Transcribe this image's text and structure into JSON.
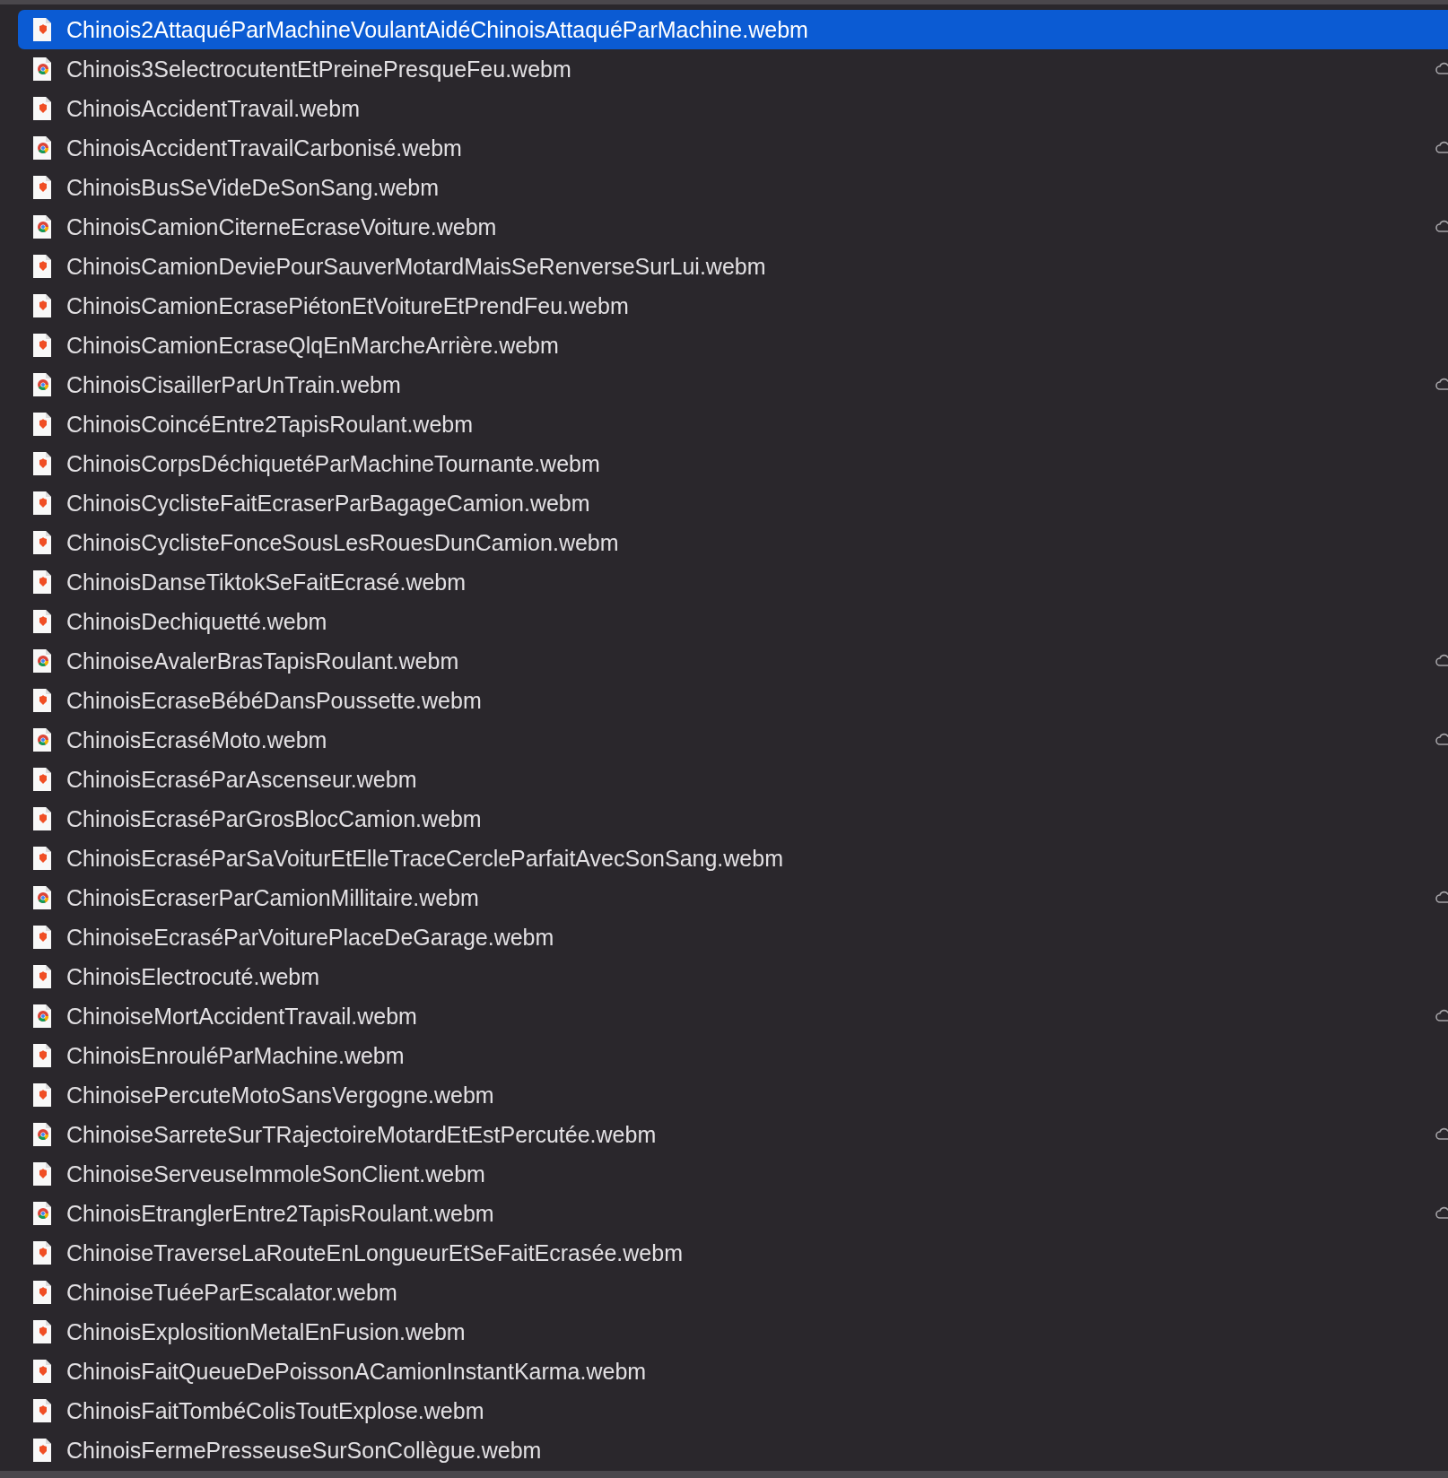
{
  "files": [
    {
      "name": "Chinois2AttaquéParMachineVoulantAidéChinoisAttaquéParMachine.webm",
      "kind": "shield",
      "cloud": false,
      "selected": true
    },
    {
      "name": "Chinois3SelectrocutentEtPreinePresqueFeu.webm",
      "kind": "globe",
      "cloud": true,
      "selected": false
    },
    {
      "name": "ChinoisAccidentTravail.webm",
      "kind": "shield",
      "cloud": false,
      "selected": false
    },
    {
      "name": "ChinoisAccidentTravailCarbonisé.webm",
      "kind": "globe",
      "cloud": true,
      "selected": false
    },
    {
      "name": "ChinoisBusSeVideDeSonSang.webm",
      "kind": "shield",
      "cloud": false,
      "selected": false
    },
    {
      "name": "ChinoisCamionCiterneEcraseVoiture.webm",
      "kind": "globe",
      "cloud": true,
      "selected": false
    },
    {
      "name": "ChinoisCamionDeviePourSauverMotardMaisSeRenverseSurLui.webm",
      "kind": "shield",
      "cloud": false,
      "selected": false
    },
    {
      "name": "ChinoisCamionEcrasePiétonEtVoitureEtPrendFeu.webm",
      "kind": "shield",
      "cloud": false,
      "selected": false
    },
    {
      "name": "ChinoisCamionEcraseQlqEnMarcheArrière.webm",
      "kind": "shield",
      "cloud": false,
      "selected": false
    },
    {
      "name": "ChinoisCisaillerParUnTrain.webm",
      "kind": "globe",
      "cloud": true,
      "selected": false
    },
    {
      "name": "ChinoisCoincéEntre2TapisRoulant.webm",
      "kind": "shield",
      "cloud": false,
      "selected": false
    },
    {
      "name": "ChinoisCorpsDéchiquetéParMachineTournante.webm",
      "kind": "shield",
      "cloud": false,
      "selected": false
    },
    {
      "name": "ChinoisCyclisteFaitEcraserParBagageCamion.webm",
      "kind": "shield",
      "cloud": false,
      "selected": false
    },
    {
      "name": "ChinoisCyclisteFonceSousLesRouesDunCamion.webm",
      "kind": "shield",
      "cloud": false,
      "selected": false
    },
    {
      "name": "ChinoisDanseTiktokSeFaitEcrasé.webm",
      "kind": "shield",
      "cloud": false,
      "selected": false
    },
    {
      "name": "ChinoisDechiquetté.webm",
      "kind": "shield",
      "cloud": false,
      "selected": false
    },
    {
      "name": "ChinoiseAvalerBrasTapisRoulant.webm",
      "kind": "globe",
      "cloud": true,
      "selected": false
    },
    {
      "name": "ChinoisEcraseBébéDansPoussette.webm",
      "kind": "shield",
      "cloud": false,
      "selected": false
    },
    {
      "name": "ChinoisEcraséMoto.webm",
      "kind": "globe",
      "cloud": true,
      "selected": false
    },
    {
      "name": "ChinoisEcraséParAscenseur.webm",
      "kind": "shield",
      "cloud": false,
      "selected": false
    },
    {
      "name": "ChinoisEcraséParGrosBlocCamion.webm",
      "kind": "shield",
      "cloud": false,
      "selected": false
    },
    {
      "name": "ChinoisEcraséParSaVoiturEtElleTraceCercleParfaitAvecSonSang.webm",
      "kind": "shield",
      "cloud": false,
      "selected": false
    },
    {
      "name": "ChinoisEcraserParCamionMillitaire.webm",
      "kind": "globe",
      "cloud": true,
      "selected": false
    },
    {
      "name": "ChinoiseEcraséParVoiturePlaceDeGarage.webm",
      "kind": "shield",
      "cloud": false,
      "selected": false
    },
    {
      "name": "ChinoisElectrocuté.webm",
      "kind": "shield",
      "cloud": false,
      "selected": false
    },
    {
      "name": "ChinoiseMortAccidentTravail.webm",
      "kind": "globe",
      "cloud": true,
      "selected": false
    },
    {
      "name": "ChinoisEnrouléParMachine.webm",
      "kind": "shield",
      "cloud": false,
      "selected": false
    },
    {
      "name": "ChinoisePercuteMotoSansVergogne.webm",
      "kind": "shield",
      "cloud": false,
      "selected": false
    },
    {
      "name": "ChinoiseSarreteSurTRajectoireMotardEtEstPercutée.webm",
      "kind": "globe",
      "cloud": true,
      "selected": false
    },
    {
      "name": "ChinoiseServeuseImmoleSonClient.webm",
      "kind": "shield",
      "cloud": false,
      "selected": false
    },
    {
      "name": "ChinoisEtranglerEntre2TapisRoulant.webm",
      "kind": "globe",
      "cloud": true,
      "selected": false
    },
    {
      "name": "ChinoiseTraverseLaRouteEnLongueurEtSeFaitEcrasée.webm",
      "kind": "shield",
      "cloud": false,
      "selected": false
    },
    {
      "name": "ChinoiseTuéeParEscalator.webm",
      "kind": "shield",
      "cloud": false,
      "selected": false
    },
    {
      "name": "ChinoisExplositionMetalEnFusion.webm",
      "kind": "shield",
      "cloud": false,
      "selected": false
    },
    {
      "name": "ChinoisFaitQueueDePoissonACamionInstantKarma.webm",
      "kind": "shield",
      "cloud": false,
      "selected": false
    },
    {
      "name": "ChinoisFaitTombéColisToutExplose.webm",
      "kind": "shield",
      "cloud": false,
      "selected": false
    },
    {
      "name": "ChinoisFermePresseuseSurSonCollègue.webm",
      "kind": "shield",
      "cloud": false,
      "selected": false
    }
  ]
}
